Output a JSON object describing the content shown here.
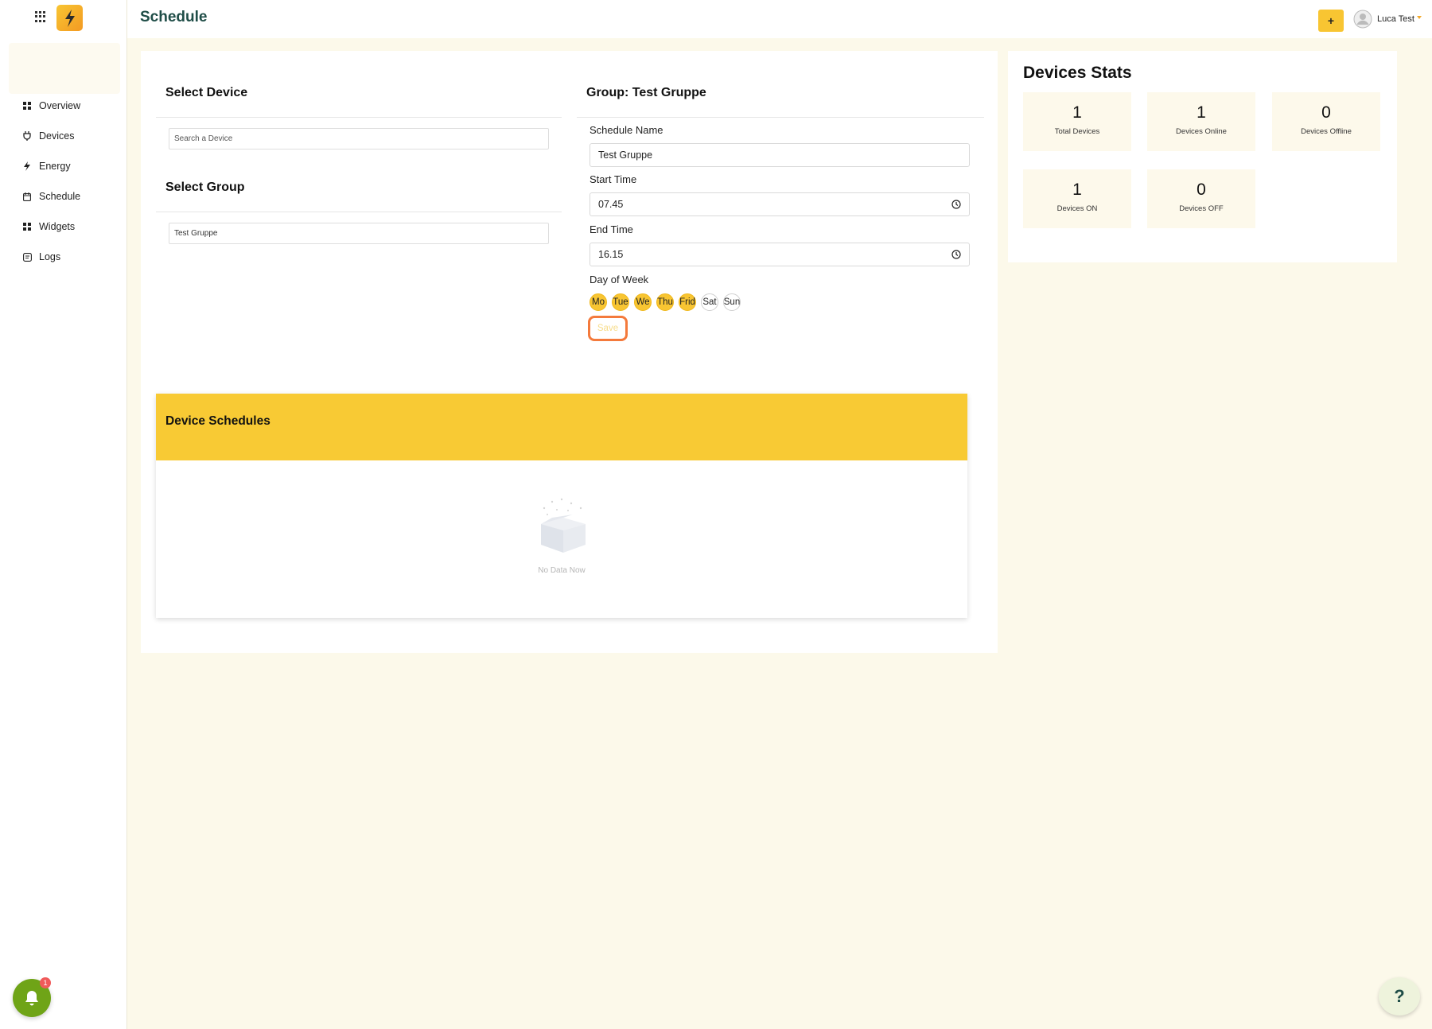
{
  "header": {
    "title": "Schedule",
    "add_label": "+",
    "user_name": "Luca Test"
  },
  "sidebar": {
    "items": [
      {
        "label": "Overview",
        "icon": "grid-icon"
      },
      {
        "label": "Devices",
        "icon": "plug-icon"
      },
      {
        "label": "Energy",
        "icon": "bolt-icon"
      },
      {
        "label": "Schedule",
        "icon": "calendar-icon"
      },
      {
        "label": "Widgets",
        "icon": "grid-icon"
      },
      {
        "label": "Logs",
        "icon": "log-icon"
      }
    ],
    "notification_count": "1"
  },
  "select_device": {
    "title": "Select Device",
    "search_placeholder": "Search a Device"
  },
  "select_group": {
    "title": "Select Group",
    "value": "Test Gruppe"
  },
  "group_form": {
    "title": "Group: Test Gruppe",
    "name_label": "Schedule Name",
    "name_value": "Test Gruppe",
    "start_label": "Start Time",
    "start_value": "07.45",
    "end_label": "End Time",
    "end_value": "16.15",
    "dow_label": "Day of Week",
    "days": [
      {
        "label": "Mo",
        "selected": true
      },
      {
        "label": "Tue",
        "selected": true
      },
      {
        "label": "We",
        "selected": true
      },
      {
        "label": "Thu",
        "selected": true
      },
      {
        "label": "Frid",
        "selected": true
      },
      {
        "label": "Sat",
        "selected": false
      },
      {
        "label": "Sun",
        "selected": false
      }
    ],
    "save_label": "Save"
  },
  "device_schedules": {
    "title": "Device Schedules",
    "empty_text": "No Data Now"
  },
  "stats": {
    "title": "Devices Stats",
    "items": [
      {
        "value": "1",
        "label": "Total Devices"
      },
      {
        "value": "1",
        "label": "Devices Online"
      },
      {
        "value": "0",
        "label": "Devices Offline"
      },
      {
        "value": "1",
        "label": "Devices ON"
      },
      {
        "value": "0",
        "label": "Devices OFF"
      }
    ]
  },
  "help_label": "?",
  "colors": {
    "accent": "#f8c532",
    "title_green": "#1f4d47",
    "save_border": "#f47a3c",
    "notification_green": "#6fa417"
  }
}
